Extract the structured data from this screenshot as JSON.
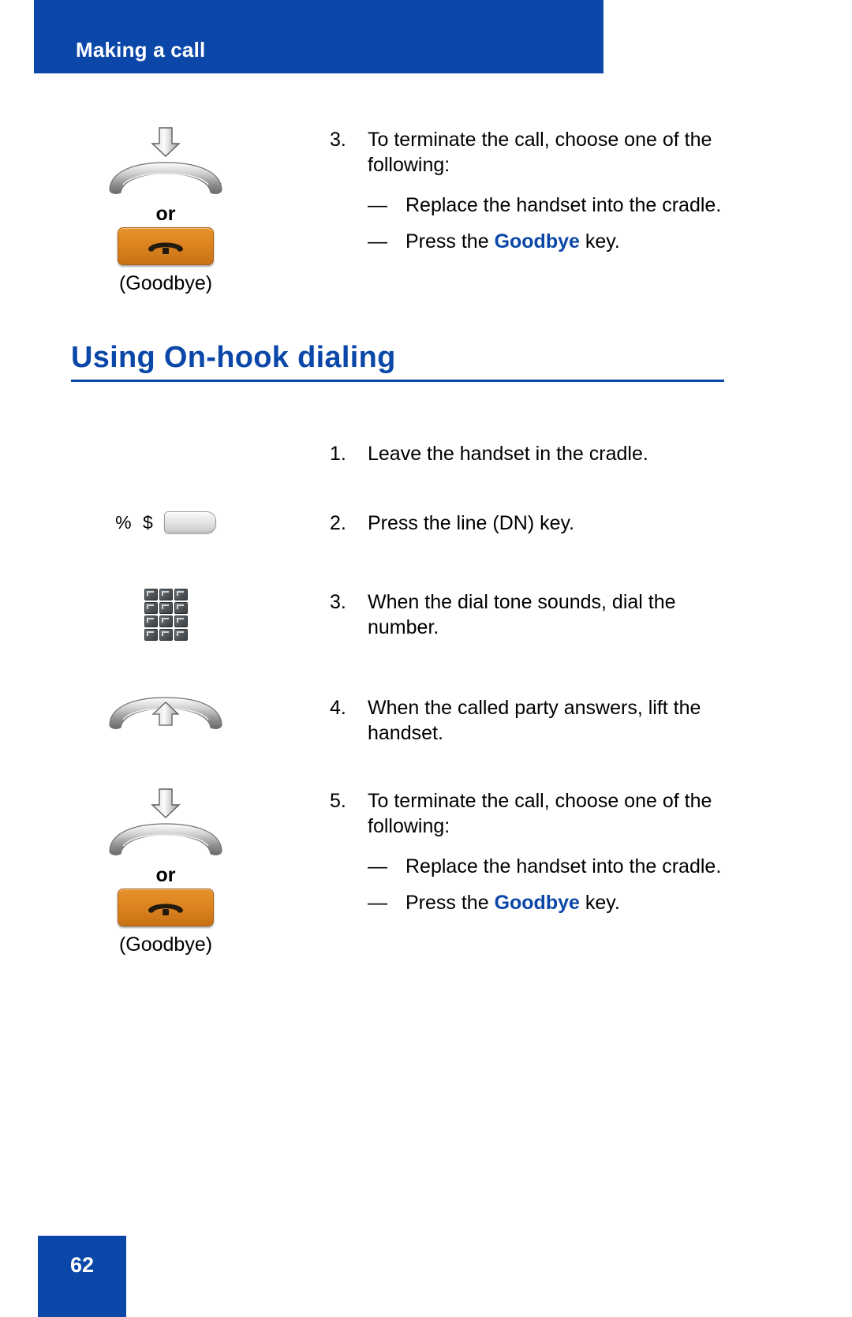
{
  "header": {
    "title": "Making a call",
    "bar_color": "#0b47a8"
  },
  "section": {
    "heading": "Using On-hook dialing",
    "heading_color": "#0b47a8"
  },
  "blocks": [
    {
      "id": "terminate-call-top",
      "icons": {
        "handset_down_name": "handset-down-icon",
        "or_label": "or",
        "goodbye_key_label": "(Goodbye)"
      },
      "step": {
        "number": "3.",
        "text": "To terminate the call, choose one of the following:"
      },
      "subs": [
        {
          "dash": "—",
          "text": "Replace the handset into the cradle."
        },
        {
          "dash": "—",
          "prefix": "Press the ",
          "keyword": "Goodbye",
          "suffix": " key."
        }
      ]
    },
    {
      "id": "onhook-step-1",
      "step": {
        "number": "1.",
        "text": "Leave the handset in the cradle."
      }
    },
    {
      "id": "onhook-step-2",
      "icons": {
        "dn_chars": "% $",
        "dn_key_name": "line-dn-key"
      },
      "step": {
        "number": "2.",
        "text": "Press the line (DN) key."
      }
    },
    {
      "id": "onhook-step-3",
      "icons": {
        "dialpad_name": "dialpad-icon"
      },
      "step": {
        "number": "3.",
        "text": "When the dial tone sounds, dial the number."
      }
    },
    {
      "id": "onhook-step-4",
      "icons": {
        "handset_up_name": "handset-up-icon"
      },
      "step": {
        "number": "4.",
        "text": "When the called party answers, lift the handset."
      }
    },
    {
      "id": "onhook-step-5",
      "icons": {
        "handset_down_name": "handset-down-icon",
        "or_label": "or",
        "goodbye_key_label": "(Goodbye)"
      },
      "step": {
        "number": "5.",
        "text": "To terminate the call, choose one of the following:"
      },
      "subs": [
        {
          "dash": "—",
          "text": "Replace the handset into the cradle."
        },
        {
          "dash": "—",
          "prefix": "Press the ",
          "keyword": "Goodbye",
          "suffix": " key."
        }
      ]
    }
  ],
  "footer": {
    "page_number": "62",
    "box_color": "#0b47a8"
  }
}
